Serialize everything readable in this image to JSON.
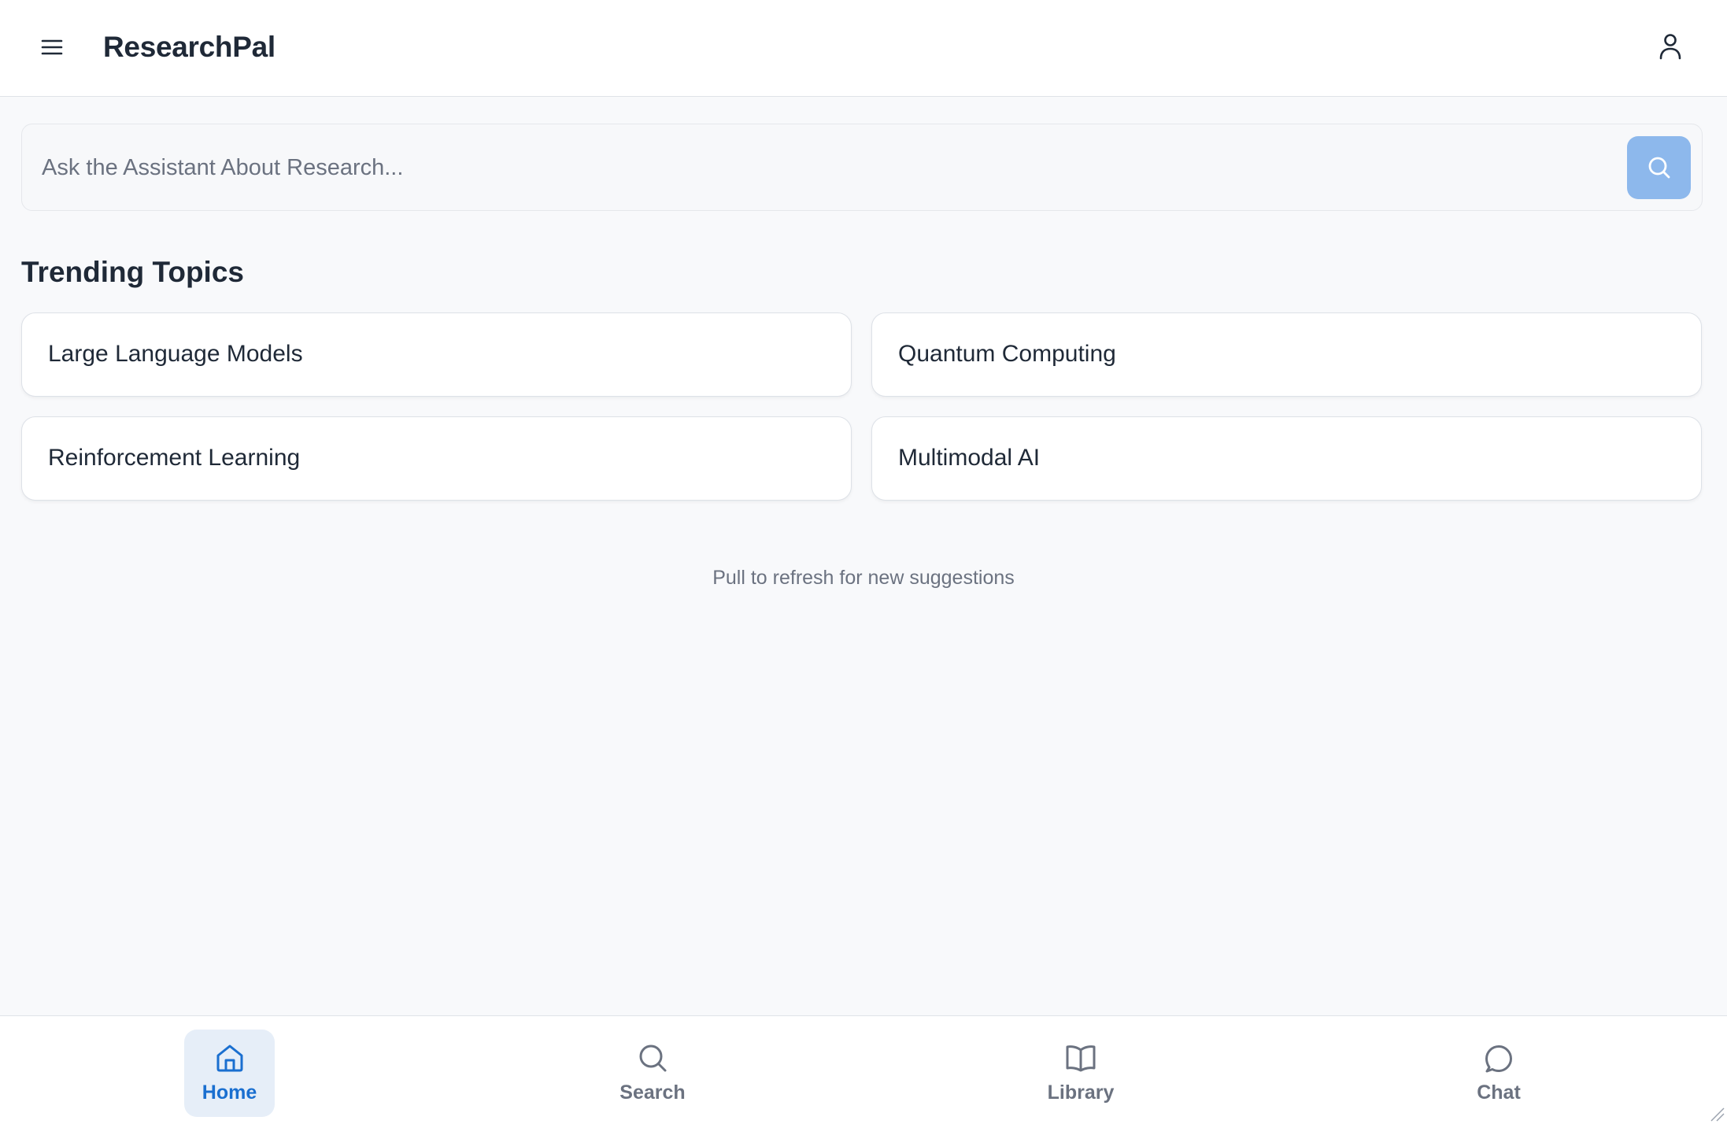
{
  "header": {
    "title": "ResearchPal",
    "menu_icon": "menu-icon",
    "profile_icon": "user-icon"
  },
  "search": {
    "placeholder": "Ask the Assistant About Research...",
    "value": "",
    "button_icon": "search-icon"
  },
  "trending": {
    "title": "Trending Topics",
    "topics": [
      {
        "label": "Large Language Models"
      },
      {
        "label": "Quantum Computing"
      },
      {
        "label": "Reinforcement Learning"
      },
      {
        "label": "Multimodal AI"
      }
    ]
  },
  "hint": "Pull to refresh for new suggestions",
  "bottom_nav": {
    "items": [
      {
        "label": "Home",
        "icon": "home-icon",
        "active": true
      },
      {
        "label": "Search",
        "icon": "search-icon",
        "active": false
      },
      {
        "label": "Library",
        "icon": "book-icon",
        "active": false
      },
      {
        "label": "Chat",
        "icon": "chat-bubble-icon",
        "active": false
      }
    ]
  },
  "colors": {
    "accent": "#1a6fd0",
    "search_button": "#8db8ec",
    "active_nav_bg": "#e6eef8",
    "background": "#f8f9fb",
    "muted_text": "#6b7280"
  }
}
